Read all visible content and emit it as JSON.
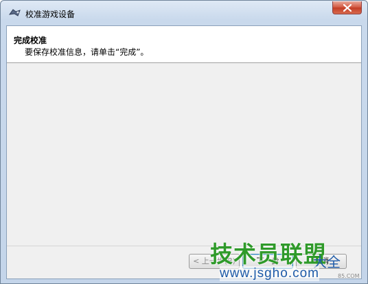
{
  "window": {
    "title": "校准游戏设备",
    "close_icon": "close-icon",
    "app_icon": "game-controller-icon"
  },
  "header": {
    "title": "完成校准",
    "subtitle": "要保存校准信息，请单击“完成”。"
  },
  "buttons": {
    "back": "< 上一步(B)",
    "next": "下一步",
    "cancel": "取消"
  },
  "watermark": {
    "main": "技术员联盟",
    "tail": "大全",
    "url": "www.jsgho.com",
    "small": "85.COM"
  },
  "colors": {
    "client_bg": "#f0f0f0",
    "frame": "#c4d5ea",
    "watermark_green": "#2f9a2a",
    "watermark_blue": "#1d5aa8"
  }
}
